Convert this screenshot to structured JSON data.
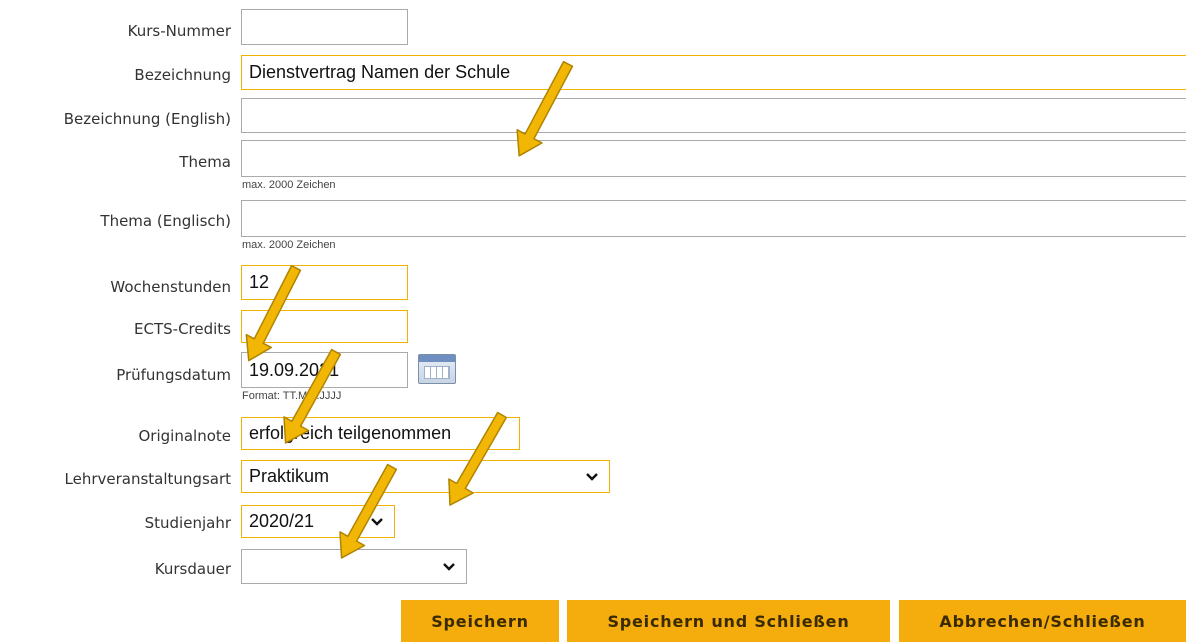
{
  "form": {
    "kurs_nummer": {
      "label": "Kurs-Nummer",
      "value": ""
    },
    "bezeichnung": {
      "label": "Bezeichnung",
      "value": "Dienstvertrag Namen der Schule"
    },
    "bezeichnung_en": {
      "label": "Bezeichnung (English)",
      "value": ""
    },
    "thema": {
      "label": "Thema",
      "value": "",
      "hint": "max. 2000 Zeichen"
    },
    "thema_en": {
      "label": "Thema (Englisch)",
      "value": "",
      "hint": "max. 2000 Zeichen"
    },
    "wochenstunden": {
      "label": "Wochenstunden",
      "value": "12"
    },
    "ects": {
      "label": "ECTS-Credits",
      "value": ""
    },
    "pruefungsdatum": {
      "label": "Prüfungsdatum",
      "value": "19.09.2021",
      "hint": "Format: TT.MM.JJJJ"
    },
    "originalnote": {
      "label": "Originalnote",
      "value": "erfolgreich teilgenommen"
    },
    "lv_art": {
      "label": "Lehrveranstaltungsart",
      "value": "Praktikum"
    },
    "studienjahr": {
      "label": "Studienjahr",
      "value": "2020/21"
    },
    "kursdauer": {
      "label": "Kursdauer",
      "value": ""
    }
  },
  "buttons": {
    "save": "Speichern",
    "save_close": "Speichern und Schließen",
    "cancel": "Abbrechen/Schließen"
  },
  "icons": {
    "calendar": "calendar-icon",
    "chevron": "chevron-down-icon",
    "arrow": "arrow-annotation-icon"
  },
  "colors": {
    "accent": "#f5ac0d",
    "highlight_border": "#f0b400",
    "arrow_fill": "#f2b705",
    "arrow_stroke": "#b08400"
  }
}
